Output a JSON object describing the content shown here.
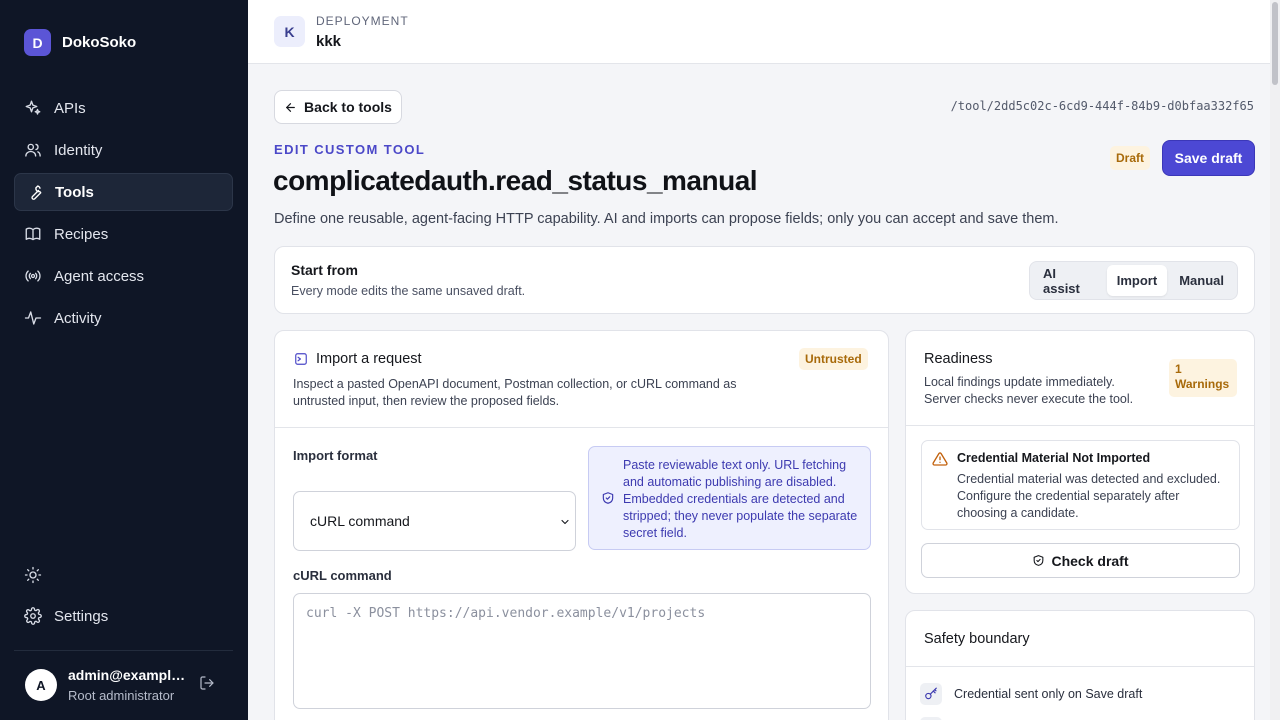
{
  "sidebar": {
    "brand_initial": "D",
    "brand_name": "DokoSoko",
    "items": [
      {
        "label": "APIs",
        "icon": "sparkle-icon"
      },
      {
        "label": "Identity",
        "icon": "users-icon"
      },
      {
        "label": "Tools",
        "icon": "wrench-icon",
        "active": true
      },
      {
        "label": "Recipes",
        "icon": "book-icon"
      },
      {
        "label": "Agent access",
        "icon": "broadcast-icon"
      },
      {
        "label": "Activity",
        "icon": "activity-icon"
      }
    ],
    "settings_label": "Settings",
    "user": {
      "initial": "A",
      "email": "admin@example.com",
      "role": "Root administrator"
    }
  },
  "topbar": {
    "deployment_initial": "K",
    "deployment_label": "DEPLOYMENT",
    "deployment_name": "kkk"
  },
  "page": {
    "back_label": "Back to tools",
    "tool_path": "/tool/2dd5c02c-6cd9-444f-84b9-d0bfaa332f65",
    "eyebrow": "EDIT CUSTOM TOOL",
    "title": "complicatedauth.read_status_manual",
    "subtitle": "Define one reusable, agent-facing HTTP capability. AI and imports can propose fields; only you can accept and save them.",
    "status_badge": "Draft",
    "save_label": "Save draft"
  },
  "start_from": {
    "title": "Start from",
    "description": "Every mode edits the same unsaved draft.",
    "modes": [
      "AI assist",
      "Import",
      "Manual"
    ],
    "active_mode": "Import"
  },
  "import": {
    "title": "Import a request",
    "badge": "Untrusted",
    "description": "Inspect a pasted OpenAPI document, Postman collection, or cURL command as untrusted input, then review the proposed fields.",
    "format_label": "Import format",
    "format_value": "cURL command",
    "info_text": "Paste reviewable text only. URL fetching and automatic publishing are disabled. Embedded credentials are detected and stripped; they never populate the separate secret field.",
    "curl_label": "cURL command",
    "curl_placeholder": "curl -X POST https://api.vendor.example/v1/projects"
  },
  "readiness": {
    "title": "Readiness",
    "description": "Local findings update immediately. Server checks never execute the tool.",
    "warnings_count": "1",
    "warnings_label": "Warnings",
    "finding_title": "Credential Material Not Imported",
    "finding_text": "Credential material was detected and excluded. Configure the credential separately after choosing a candidate.",
    "check_label": "Check draft"
  },
  "safety": {
    "title": "Safety boundary",
    "row1": "Credential sent only on Save draft"
  },
  "colors": {
    "sidebar_bg": "#0f1626",
    "accent": "#4c48d4",
    "warning": "#a86a0a",
    "warning_bg": "#fdf3e0"
  }
}
